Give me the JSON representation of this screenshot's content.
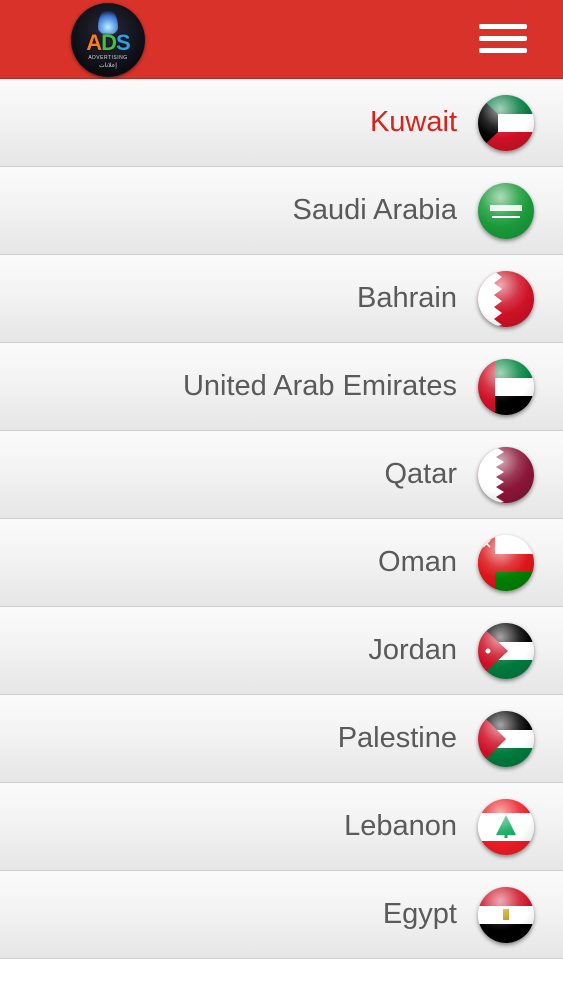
{
  "header": {
    "logo_text": "ADS",
    "logo_subtitle": "ADVERTISING",
    "logo_subtitle_ar": "إعلانات",
    "menu_icon": "hamburger-menu-icon",
    "background_color": "#d8322a"
  },
  "countries": [
    {
      "label": "Kuwait",
      "flag_icon": "kuwait-flag-icon",
      "active": true
    },
    {
      "label": "Saudi Arabia",
      "flag_icon": "saudi-arabia-flag-icon",
      "active": false
    },
    {
      "label": "Bahrain",
      "flag_icon": "bahrain-flag-icon",
      "active": false
    },
    {
      "label": "United Arab Emirates",
      "flag_icon": "uae-flag-icon",
      "active": false
    },
    {
      "label": "Qatar",
      "flag_icon": "qatar-flag-icon",
      "active": false
    },
    {
      "label": "Oman",
      "flag_icon": "oman-flag-icon",
      "active": false
    },
    {
      "label": "Jordan",
      "flag_icon": "jordan-flag-icon",
      "active": false
    },
    {
      "label": "Palestine",
      "flag_icon": "palestine-flag-icon",
      "active": false
    },
    {
      "label": "Lebanon",
      "flag_icon": "lebanon-flag-icon",
      "active": false
    },
    {
      "label": "Egypt",
      "flag_icon": "egypt-flag-icon",
      "active": false
    }
  ],
  "colors": {
    "active_text": "#d3241d",
    "inactive_text": "#5a5a5a"
  }
}
